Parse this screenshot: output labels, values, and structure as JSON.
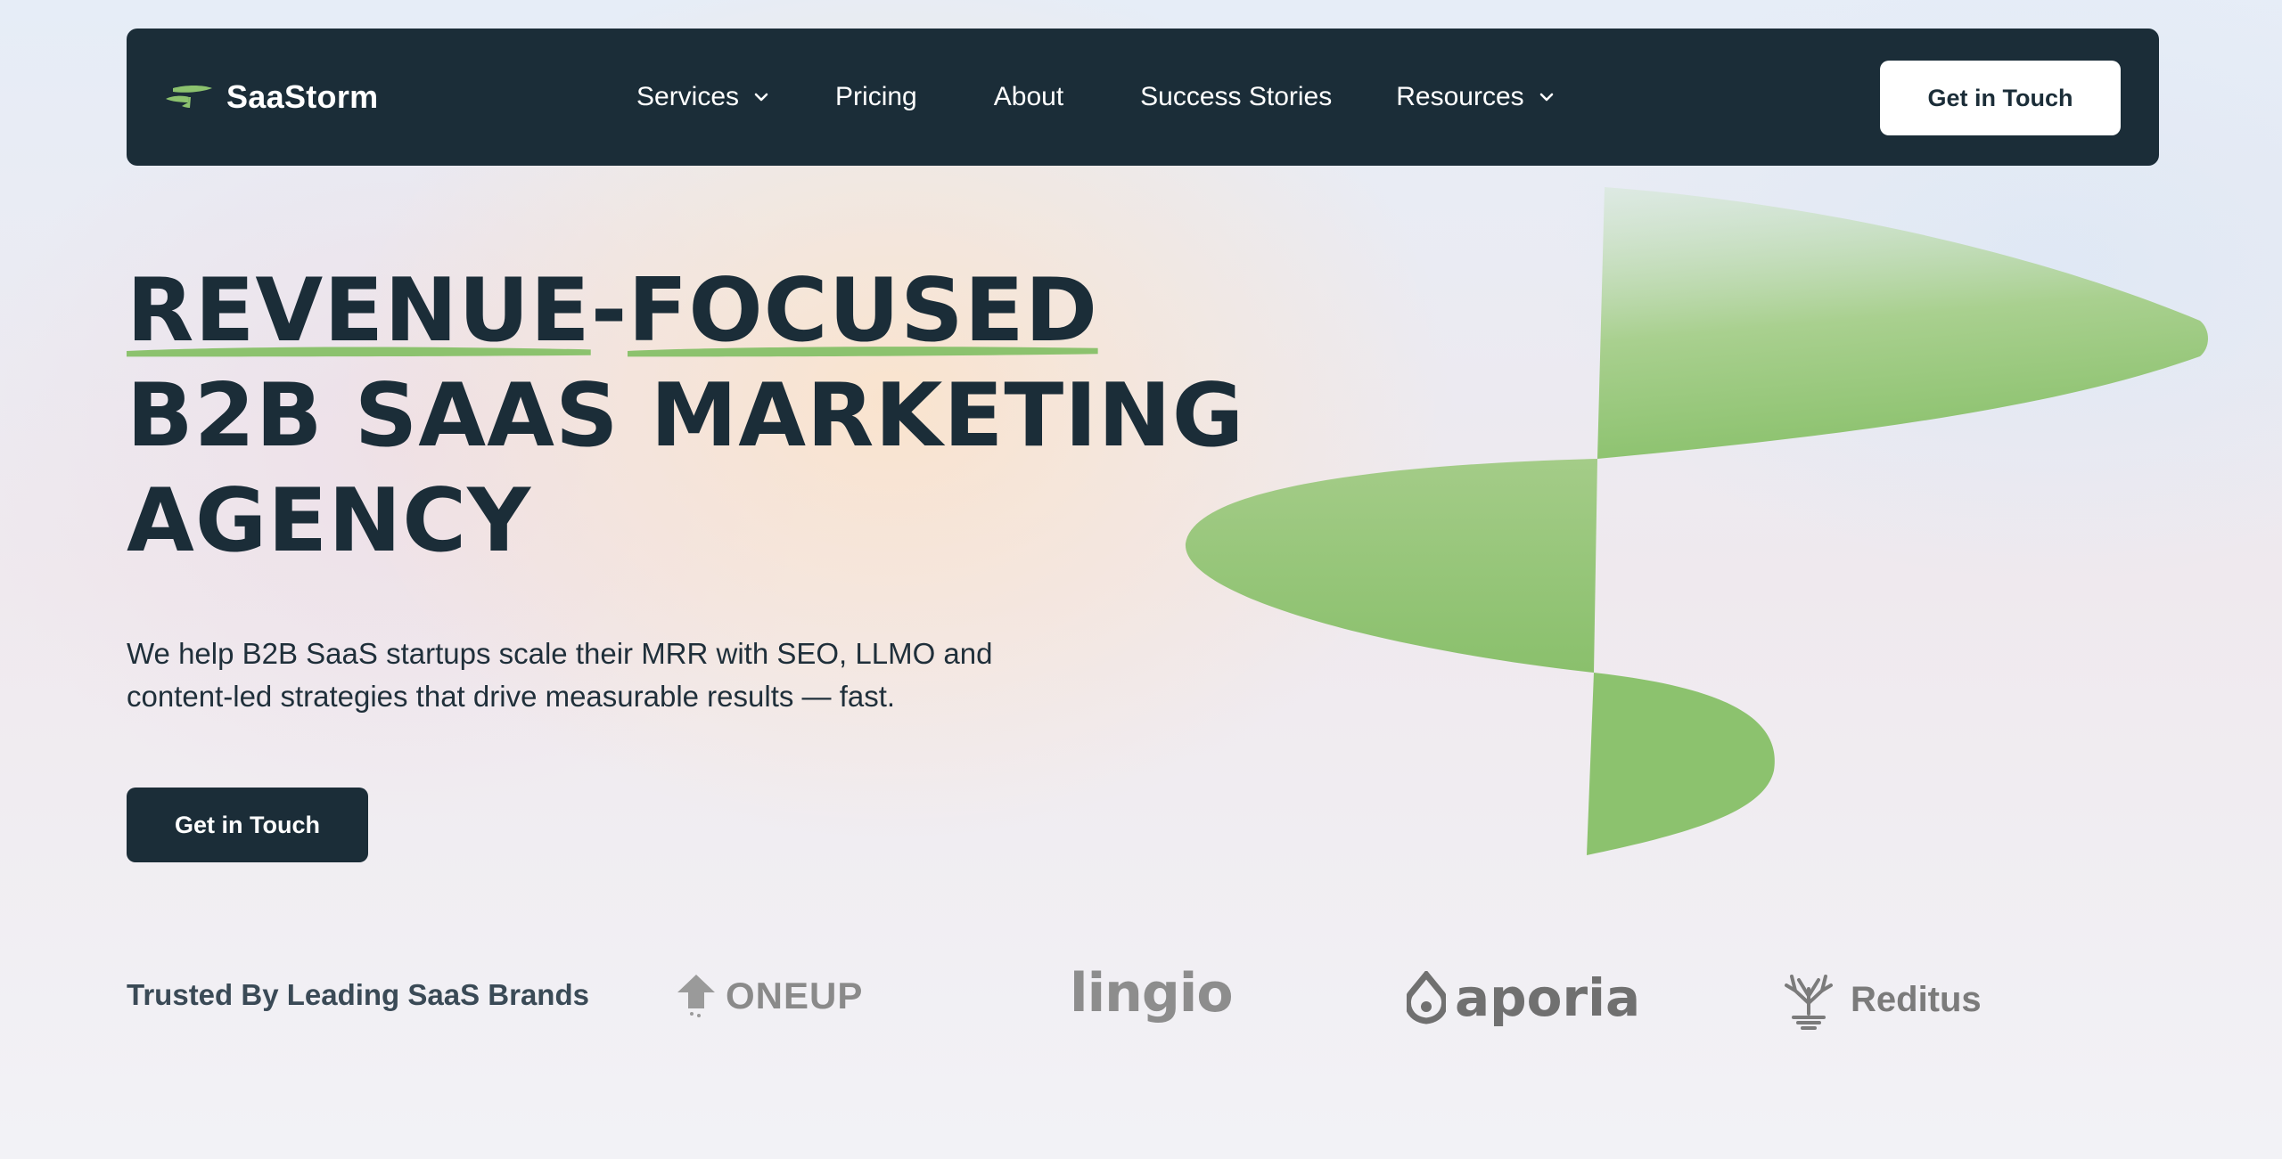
{
  "nav": {
    "brand": "SaaStorm",
    "items": [
      {
        "label": "Services",
        "has_dropdown": true
      },
      {
        "label": "Pricing",
        "has_dropdown": false
      },
      {
        "label": "About",
        "has_dropdown": false
      },
      {
        "label": "Success Stories",
        "has_dropdown": false
      },
      {
        "label": "Resources",
        "has_dropdown": true
      }
    ],
    "cta_label": "Get in Touch"
  },
  "hero": {
    "title_word_1": "REVENUE",
    "title_dash": "-",
    "title_word_2": "FOCUSED",
    "title_line_2": "B2B SAAS MARKETING",
    "title_line_3": "AGENCY",
    "subtitle_line_1": "We help B2B SaaS startups scale their MRR with SEO, LLMO and",
    "subtitle_line_2": "content-led strategies that drive measurable results — fast.",
    "cta_label": "Get in Touch"
  },
  "trusted": {
    "label": "Trusted By Leading SaaS Brands",
    "logos": [
      {
        "name": "ONEUP",
        "icon": "oneup-arrow-icon"
      },
      {
        "name": "lingio",
        "icon": ""
      },
      {
        "name": "aporia",
        "icon": "aporia-drop-icon"
      },
      {
        "name": "Reditus",
        "icon": "reditus-tree-icon"
      }
    ]
  },
  "colors": {
    "navy": "#1b2d38",
    "accent_green": "#8cc26e",
    "white": "#ffffff"
  }
}
